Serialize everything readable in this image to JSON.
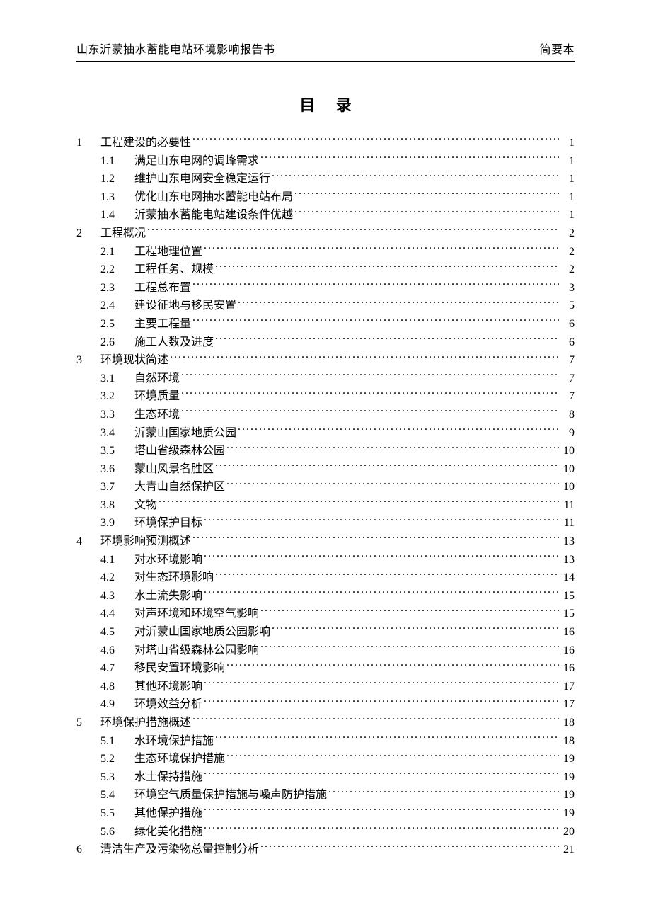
{
  "header": {
    "left": "山东沂蒙抽水蓄能电站环境影响报告书",
    "right": "简要本"
  },
  "title": "目 录",
  "toc": [
    {
      "level": 1,
      "num": "1",
      "text": "工程建设的必要性",
      "page": "1"
    },
    {
      "level": 2,
      "num": "1.1",
      "text": "满足山东电网的调峰需求",
      "page": "1"
    },
    {
      "level": 2,
      "num": "1.2",
      "text": "维护山东电网安全稳定运行",
      "page": "1"
    },
    {
      "level": 2,
      "num": "1.3",
      "text": "优化山东电网抽水蓄能电站布局",
      "page": "1"
    },
    {
      "level": 2,
      "num": "1.4",
      "text": "沂蒙抽水蓄能电站建设条件优越",
      "page": "1"
    },
    {
      "level": 1,
      "num": "2",
      "text": "工程概况",
      "page": "2"
    },
    {
      "level": 2,
      "num": "2.1",
      "text": "工程地理位置",
      "page": "2"
    },
    {
      "level": 2,
      "num": "2.2",
      "text": "工程任务、规模",
      "page": "2"
    },
    {
      "level": 2,
      "num": "2.3",
      "text": "工程总布置",
      "page": "3"
    },
    {
      "level": 2,
      "num": "2.4",
      "text": "建设征地与移民安置",
      "page": "5"
    },
    {
      "level": 2,
      "num": "2.5",
      "text": "主要工程量",
      "page": "6"
    },
    {
      "level": 2,
      "num": "2.6",
      "text": "施工人数及进度",
      "page": "6"
    },
    {
      "level": 1,
      "num": "3",
      "text": "环境现状简述",
      "page": "7"
    },
    {
      "level": 2,
      "num": "3.1",
      "text": "自然环境",
      "page": "7"
    },
    {
      "level": 2,
      "num": "3.2",
      "text": "环境质量",
      "page": "7"
    },
    {
      "level": 2,
      "num": "3.3",
      "text": "生态环境",
      "page": "8"
    },
    {
      "level": 2,
      "num": "3.4",
      "text": "沂蒙山国家地质公园",
      "page": "9"
    },
    {
      "level": 2,
      "num": "3.5",
      "text": "塔山省级森林公园",
      "page": "10"
    },
    {
      "level": 2,
      "num": "3.6",
      "text": "蒙山风景名胜区",
      "page": "10"
    },
    {
      "level": 2,
      "num": "3.7",
      "text": "大青山自然保护区",
      "page": "10"
    },
    {
      "level": 2,
      "num": "3.8",
      "text": "文物",
      "page": "11"
    },
    {
      "level": 2,
      "num": "3.9",
      "text": "环境保护目标",
      "page": "11"
    },
    {
      "level": 1,
      "num": "4",
      "text": "环境影响预测概述",
      "page": "13"
    },
    {
      "level": 2,
      "num": "4.1",
      "text": "对水环境影响",
      "page": "13"
    },
    {
      "level": 2,
      "num": "4.2",
      "text": "对生态环境影响",
      "page": "14"
    },
    {
      "level": 2,
      "num": "4.3",
      "text": "水土流失影响",
      "page": "15"
    },
    {
      "level": 2,
      "num": "4.4",
      "text": "对声环境和环境空气影响",
      "page": "15"
    },
    {
      "level": 2,
      "num": "4.5",
      "text": "对沂蒙山国家地质公园影响",
      "page": "16"
    },
    {
      "level": 2,
      "num": "4.6",
      "text": "对塔山省级森林公园影响",
      "page": "16"
    },
    {
      "level": 2,
      "num": "4.7",
      "text": "移民安置环境影响",
      "page": "16"
    },
    {
      "level": 2,
      "num": "4.8",
      "text": "其他环境影响",
      "page": "17"
    },
    {
      "level": 2,
      "num": "4.9",
      "text": "环境效益分析",
      "page": "17"
    },
    {
      "level": 1,
      "num": "5",
      "text": "环境保护措施概述",
      "page": "18"
    },
    {
      "level": 2,
      "num": "5.1",
      "text": "水环境保护措施",
      "page": "18"
    },
    {
      "level": 2,
      "num": "5.2",
      "text": "生态环境保护措施",
      "page": "19"
    },
    {
      "level": 2,
      "num": "5.3",
      "text": "水土保持措施",
      "page": "19"
    },
    {
      "level": 2,
      "num": "5.4",
      "text": "环境空气质量保护措施与噪声防护措施",
      "page": "19"
    },
    {
      "level": 2,
      "num": "5.5",
      "text": "其他保护措施",
      "page": "19"
    },
    {
      "level": 2,
      "num": "5.6",
      "text": "绿化美化措施",
      "page": "20"
    },
    {
      "level": 1,
      "num": "6",
      "text": "清洁生产及污染物总量控制分析",
      "page": "21"
    }
  ]
}
